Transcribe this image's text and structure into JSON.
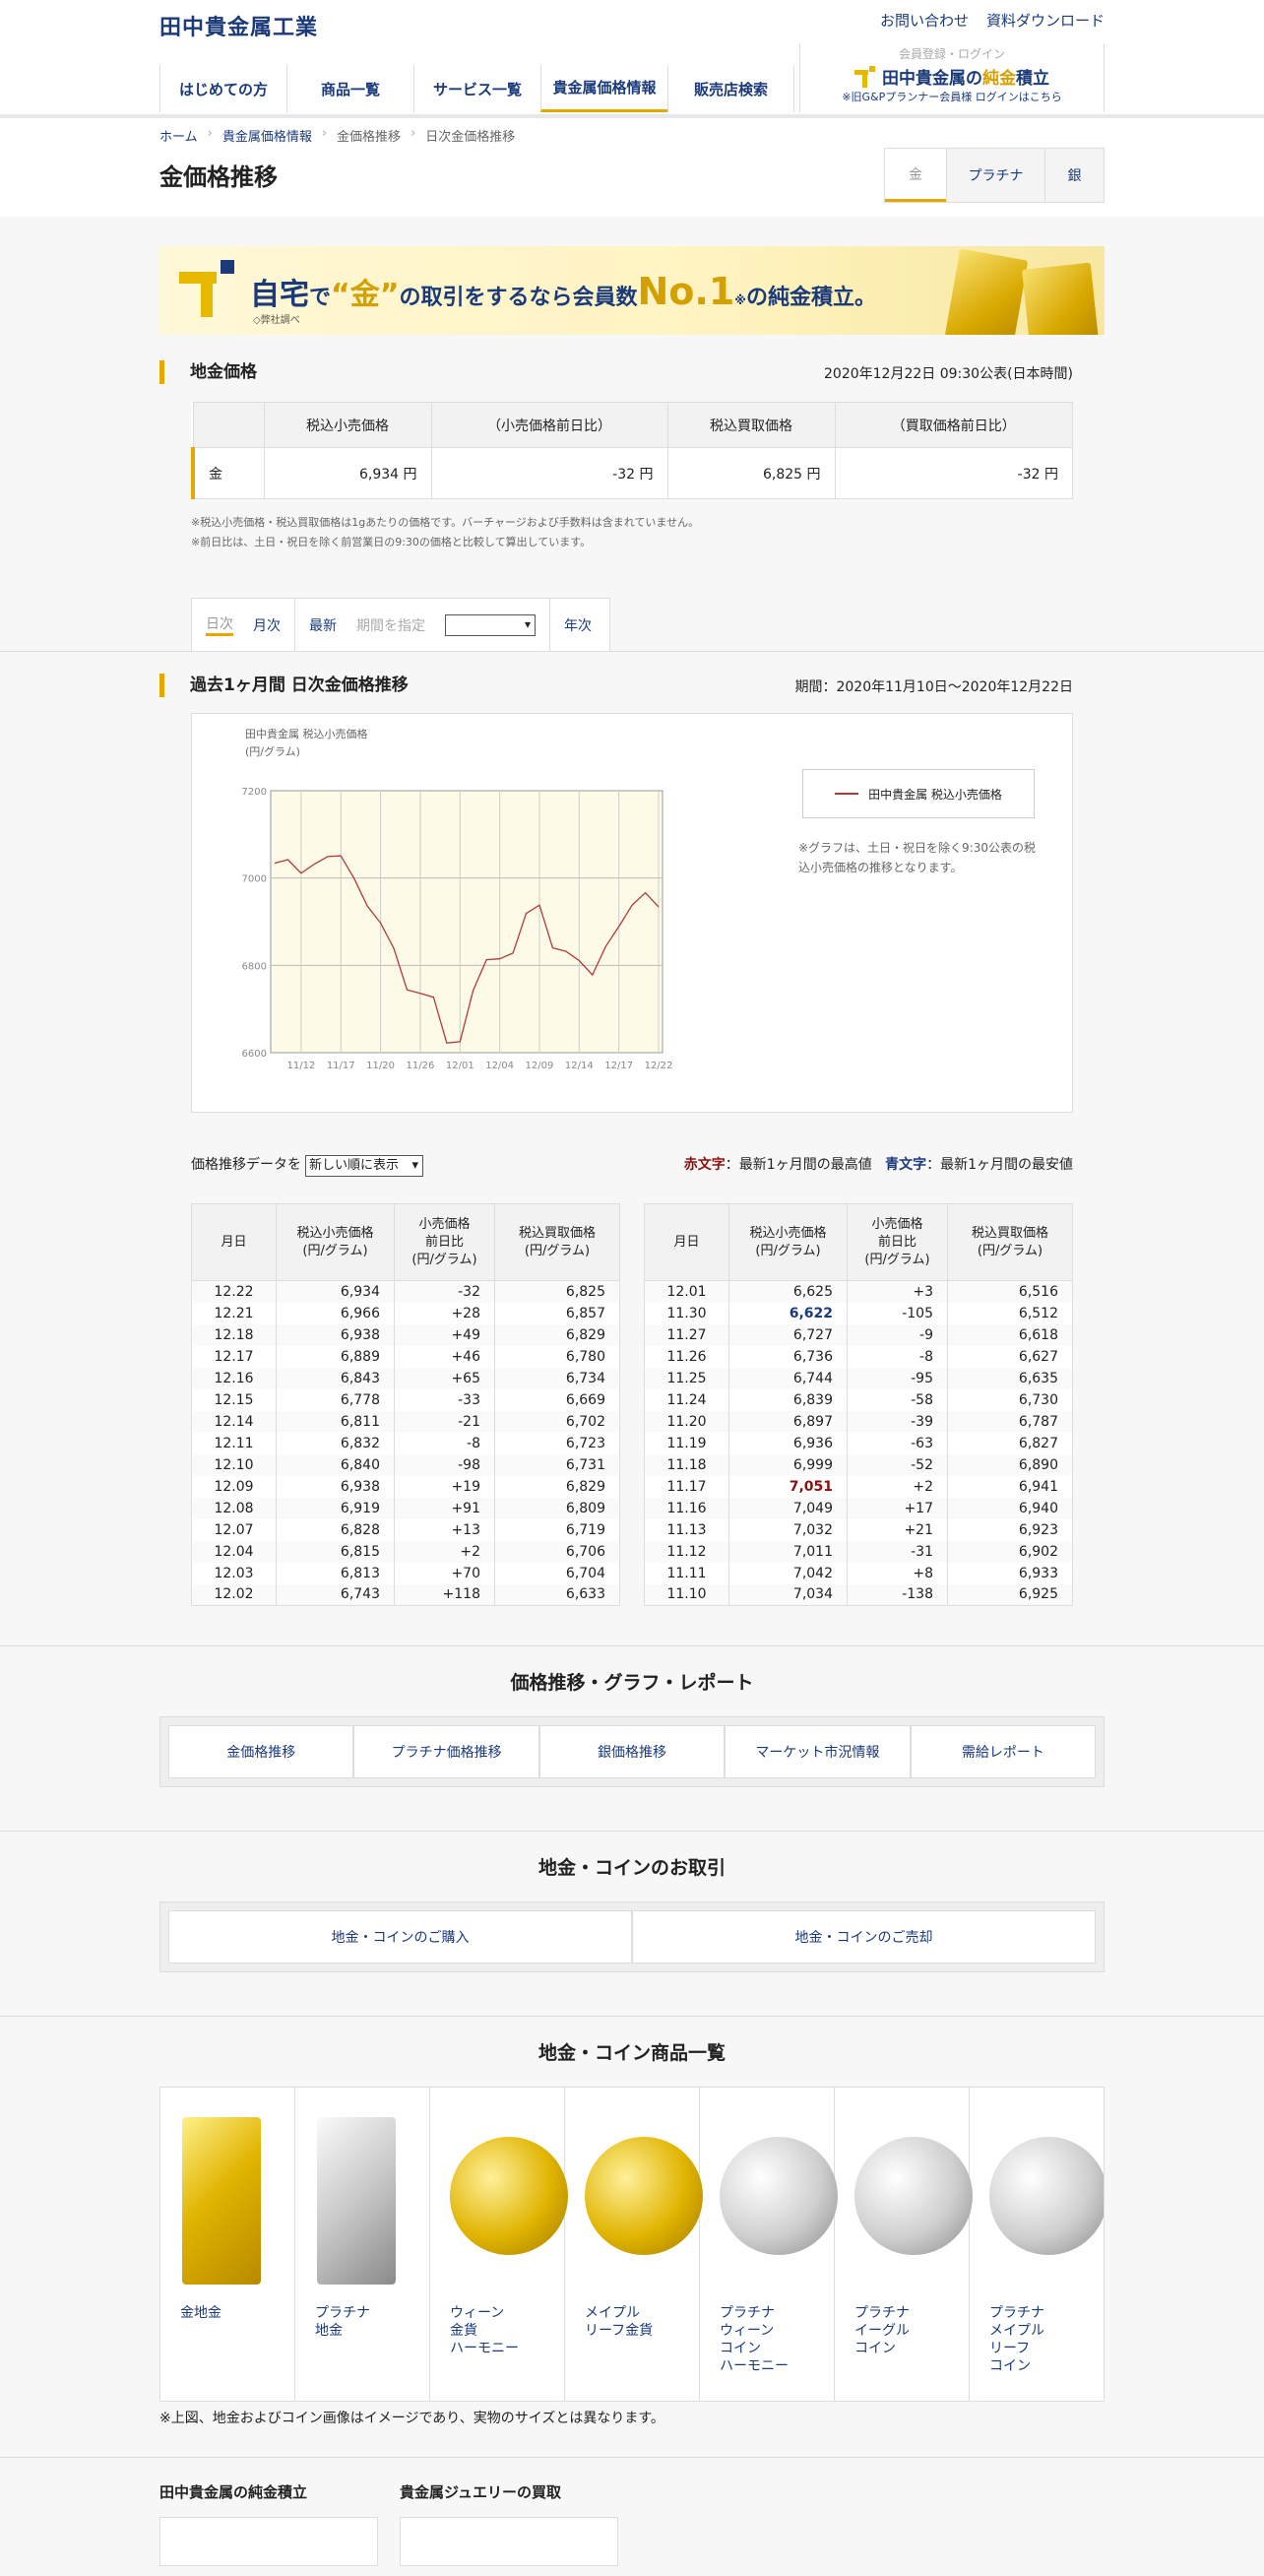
{
  "header": {
    "logo": "田中貴金属工業",
    "top_links": [
      "お問い合わせ",
      "資料ダウンロード"
    ],
    "nav": [
      "はじめての方",
      "商品一覧",
      "サービス一覧",
      "貴金属価格情報",
      "販売店検索"
    ],
    "member_login": "会員登録・ログイン",
    "member_brand_a": "田中貴金属の",
    "member_brand_b": "純金",
    "member_brand_c": "積立",
    "member_note": "※旧G&Pプランナー会員様 ログインはこちら"
  },
  "breadcrumb": [
    "ホーム",
    "貴金属価格情報",
    "金価格推移",
    "日次金価格推移"
  ],
  "page_title": "金価格推移",
  "metal_tabs": [
    "金",
    "プラチナ",
    "銀"
  ],
  "banner": {
    "text_a": "自宅",
    "text_b": "で",
    "text_c": "“金”",
    "text_d": "の取引をするなら会員数",
    "text_e": "No.1",
    "text_f": "※",
    "text_g": "の純金積立。",
    "sub": "◇弊社調べ"
  },
  "spot": {
    "title": "地金価格",
    "published": "2020年12月22日 09:30公表(日本時間)",
    "headers": [
      "",
      "税込小売価格",
      "（小売価格前日比）",
      "税込買取価格",
      "（買取価格前日比）"
    ],
    "row": [
      "金",
      "6,934 円",
      "-32 円",
      "6,825 円",
      "-32 円"
    ],
    "notes": [
      "※税込小売価格・税込買取価格は1gあたりの価格です。バーチャージおよび手数料は含まれていません。",
      "※前日比は、土日・祝日を除く前営業日の9:30の価格と比較して算出しています。"
    ]
  },
  "period": {
    "daily": "日次",
    "monthly": "月次",
    "latest": "最新",
    "specify": "期間を指定",
    "yearly": "年次"
  },
  "chart_section": {
    "title": "過去1ヶ月間 日次金価格推移",
    "range": "期間：2020年11月10日～2020年12月22日",
    "legend": "田中貴金属 税込小売価格",
    "note": "※グラフは、土日・祝日を除く9:30公表の税込小売価格の推移となります。"
  },
  "chart_data": {
    "type": "line",
    "title": "田中貴金属 税込小売価格",
    "ylabel": "(円/グラム)",
    "xlabel": "",
    "ylim": [
      6600,
      7200
    ],
    "yticks": [
      6600,
      6800,
      7000,
      7200
    ],
    "xticks": [
      "11/12",
      "11/17",
      "11/20",
      "11/26",
      "12/01",
      "12/04",
      "12/09",
      "12/14",
      "12/17",
      "12/22"
    ],
    "x": [
      "11/10",
      "11/11",
      "11/12",
      "11/13",
      "11/16",
      "11/17",
      "11/18",
      "11/19",
      "11/20",
      "11/24",
      "11/25",
      "11/26",
      "11/27",
      "11/30",
      "12/01",
      "12/02",
      "12/03",
      "12/04",
      "12/07",
      "12/08",
      "12/09",
      "12/10",
      "12/11",
      "12/14",
      "12/15",
      "12/16",
      "12/17",
      "12/18",
      "12/21",
      "12/22"
    ],
    "series": [
      {
        "name": "田中貴金属 税込小売価格",
        "values": [
          7034,
          7042,
          7011,
          7032,
          7049,
          7051,
          6999,
          6936,
          6897,
          6839,
          6744,
          6736,
          6727,
          6622,
          6625,
          6743,
          6813,
          6815,
          6828,
          6919,
          6938,
          6840,
          6832,
          6811,
          6778,
          6843,
          6889,
          6938,
          6966,
          6934
        ]
      }
    ],
    "grid": true,
    "legend": "right",
    "color": "#b03a3a"
  },
  "data_table": {
    "sort_label": "価格推移データを",
    "sort_value": "新しい順に表示",
    "red_label": "赤文字",
    "red_desc": "：最新1ヶ月間の最高値",
    "blue_label": "青文字",
    "blue_desc": "：最新1ヶ月間の最安値",
    "headers": [
      "月日",
      "税込小売価格\n(円/グラム)",
      "小売価格\n前日比\n(円/グラム)",
      "税込買取価格\n(円/グラム)"
    ],
    "left": [
      [
        "12.22",
        "6,934",
        "-32",
        "6,825"
      ],
      [
        "12.21",
        "6,966",
        "+28",
        "6,857"
      ],
      [
        "12.18",
        "6,938",
        "+49",
        "6,829"
      ],
      [
        "12.17",
        "6,889",
        "+46",
        "6,780"
      ],
      [
        "12.16",
        "6,843",
        "+65",
        "6,734"
      ],
      [
        "12.15",
        "6,778",
        "-33",
        "6,669"
      ],
      [
        "12.14",
        "6,811",
        "-21",
        "6,702"
      ],
      [
        "12.11",
        "6,832",
        "-8",
        "6,723"
      ],
      [
        "12.10",
        "6,840",
        "-98",
        "6,731"
      ],
      [
        "12.09",
        "6,938",
        "+19",
        "6,829"
      ],
      [
        "12.08",
        "6,919",
        "+91",
        "6,809"
      ],
      [
        "12.07",
        "6,828",
        "+13",
        "6,719"
      ],
      [
        "12.04",
        "6,815",
        "+2",
        "6,706"
      ],
      [
        "12.03",
        "6,813",
        "+70",
        "6,704"
      ],
      [
        "12.02",
        "6,743",
        "+118",
        "6,633"
      ]
    ],
    "right": [
      [
        "12.01",
        "6,625",
        "+3",
        "6,516"
      ],
      [
        "11.30",
        "6,622",
        "-105",
        "6,512"
      ],
      [
        "11.27",
        "6,727",
        "-9",
        "6,618"
      ],
      [
        "11.26",
        "6,736",
        "-8",
        "6,627"
      ],
      [
        "11.25",
        "6,744",
        "-95",
        "6,635"
      ],
      [
        "11.24",
        "6,839",
        "-58",
        "6,730"
      ],
      [
        "11.20",
        "6,897",
        "-39",
        "6,787"
      ],
      [
        "11.19",
        "6,936",
        "-63",
        "6,827"
      ],
      [
        "11.18",
        "6,999",
        "-52",
        "6,890"
      ],
      [
        "11.17",
        "7,051",
        "+2",
        "6,941"
      ],
      [
        "11.16",
        "7,049",
        "+17",
        "6,940"
      ],
      [
        "11.13",
        "7,032",
        "+21",
        "6,923"
      ],
      [
        "11.12",
        "7,011",
        "-31",
        "6,902"
      ],
      [
        "11.11",
        "7,042",
        "+8",
        "6,933"
      ],
      [
        "11.10",
        "7,034",
        "-138",
        "6,925"
      ]
    ],
    "max_date": "11.17",
    "min_date": "11.30"
  },
  "links_report": {
    "title": "価格推移・グラフ・レポート",
    "items": [
      "金価格推移",
      "プラチナ価格推移",
      "銀価格推移",
      "マーケット市況情報",
      "需給レポート"
    ]
  },
  "links_trade": {
    "title": "地金・コインのお取引",
    "items": [
      "地金・コインのご購入",
      "地金・コインのご売却"
    ]
  },
  "products": {
    "title": "地金・コイン商品一覧",
    "items": [
      {
        "label": "金地金",
        "kind": "goldbar"
      },
      {
        "label": "プラチナ\n地金",
        "kind": "ptbar"
      },
      {
        "label": "ウィーン\n金貨\nハーモニー",
        "kind": "coin-g"
      },
      {
        "label": "メイプル\nリーフ金貨",
        "kind": "coin-g"
      },
      {
        "label": "プラチナ\nウィーン\nコイン\nハーモニー",
        "kind": "coin-s"
      },
      {
        "label": "プラチナ\nイーグル\nコイン",
        "kind": "coin-s"
      },
      {
        "label": "プラチナ\nメイプル\nリーフ\nコイン",
        "kind": "coin-s"
      }
    ],
    "note": "※上図、地金およびコイン画像はイメージであり、実物のサイズとは異なります。"
  },
  "bottom": {
    "left_title": "田中貴金属の純金積立",
    "right_title": "貴金属ジュエリーの買取"
  }
}
